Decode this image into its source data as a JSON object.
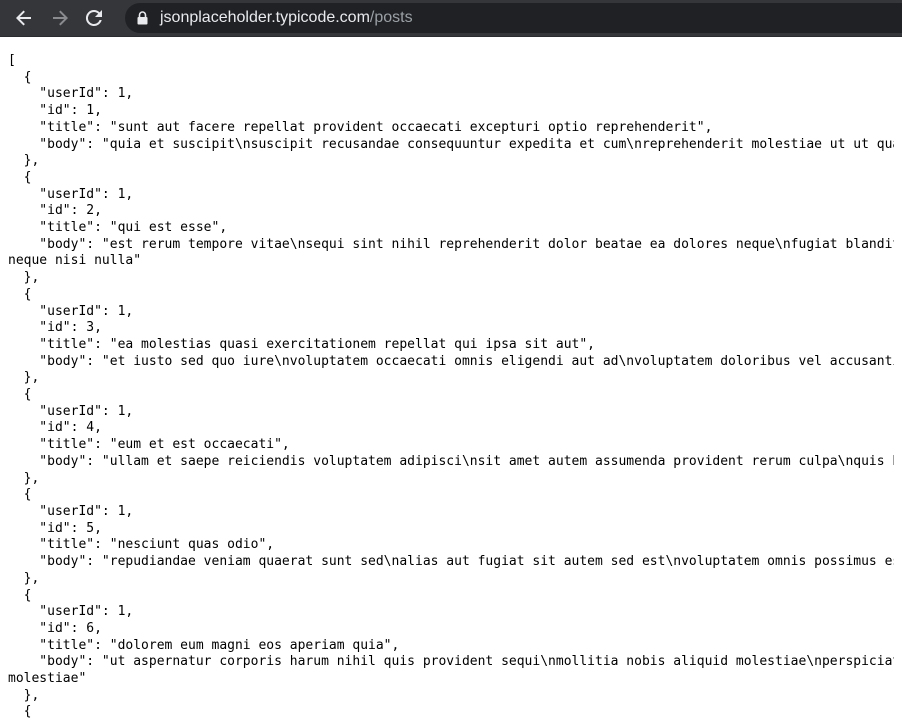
{
  "browser": {
    "url_host": "jsonplaceholder.typicode.com",
    "url_path": "/posts"
  },
  "json_lines": [
    "[",
    "  {",
    "    \"userId\": 1,",
    "    \"id\": 1,",
    "    \"title\": \"sunt aut facere repellat provident occaecati excepturi optio reprehenderit\",",
    "    \"body\": \"quia et suscipit\\nsuscipit recusandae consequuntur expedita et cum\\nreprehenderit molestiae ut ut qua",
    "  },",
    "  {",
    "    \"userId\": 1,",
    "    \"id\": 2,",
    "    \"title\": \"qui est esse\",",
    "    \"body\": \"est rerum tempore vitae\\nsequi sint nihil reprehenderit dolor beatae ea dolores neque\\nfugiat blandit",
    "neque nisi nulla\"",
    "  },",
    "  {",
    "    \"userId\": 1,",
    "    \"id\": 3,",
    "    \"title\": \"ea molestias quasi exercitationem repellat qui ipsa sit aut\",",
    "    \"body\": \"et iusto sed quo iure\\nvoluptatem occaecati omnis eligendi aut ad\\nvoluptatem doloribus vel accusanti",
    "  },",
    "  {",
    "    \"userId\": 1,",
    "    \"id\": 4,",
    "    \"title\": \"eum et est occaecati\",",
    "    \"body\": \"ullam et saepe reiciendis voluptatem adipisci\\nsit amet autem assumenda provident rerum culpa\\nquis h",
    "  },",
    "  {",
    "    \"userId\": 1,",
    "    \"id\": 5,",
    "    \"title\": \"nesciunt quas odio\",",
    "    \"body\": \"repudiandae veniam quaerat sunt sed\\nalias aut fugiat sit autem sed est\\nvoluptatem omnis possimus es",
    "  },",
    "  {",
    "    \"userId\": 1,",
    "    \"id\": 6,",
    "    \"title\": \"dolorem eum magni eos aperiam quia\",",
    "    \"body\": \"ut aspernatur corporis harum nihil quis provident sequi\\nmollitia nobis aliquid molestiae\\nperspiciat",
    "molestiae\"",
    "  },",
    "  {"
  ],
  "colors": {
    "toolbar_bg": "#35363a",
    "omnibox_bg": "#202124",
    "url_host": "#e8eaed",
    "url_path": "#9aa0a6",
    "icon": "#e8eaed",
    "icon_disabled": "#8a8b8e"
  },
  "icons": {
    "back": "arrow-left-icon",
    "forward": "arrow-right-icon",
    "reload": "reload-icon",
    "lock": "lock-icon"
  }
}
